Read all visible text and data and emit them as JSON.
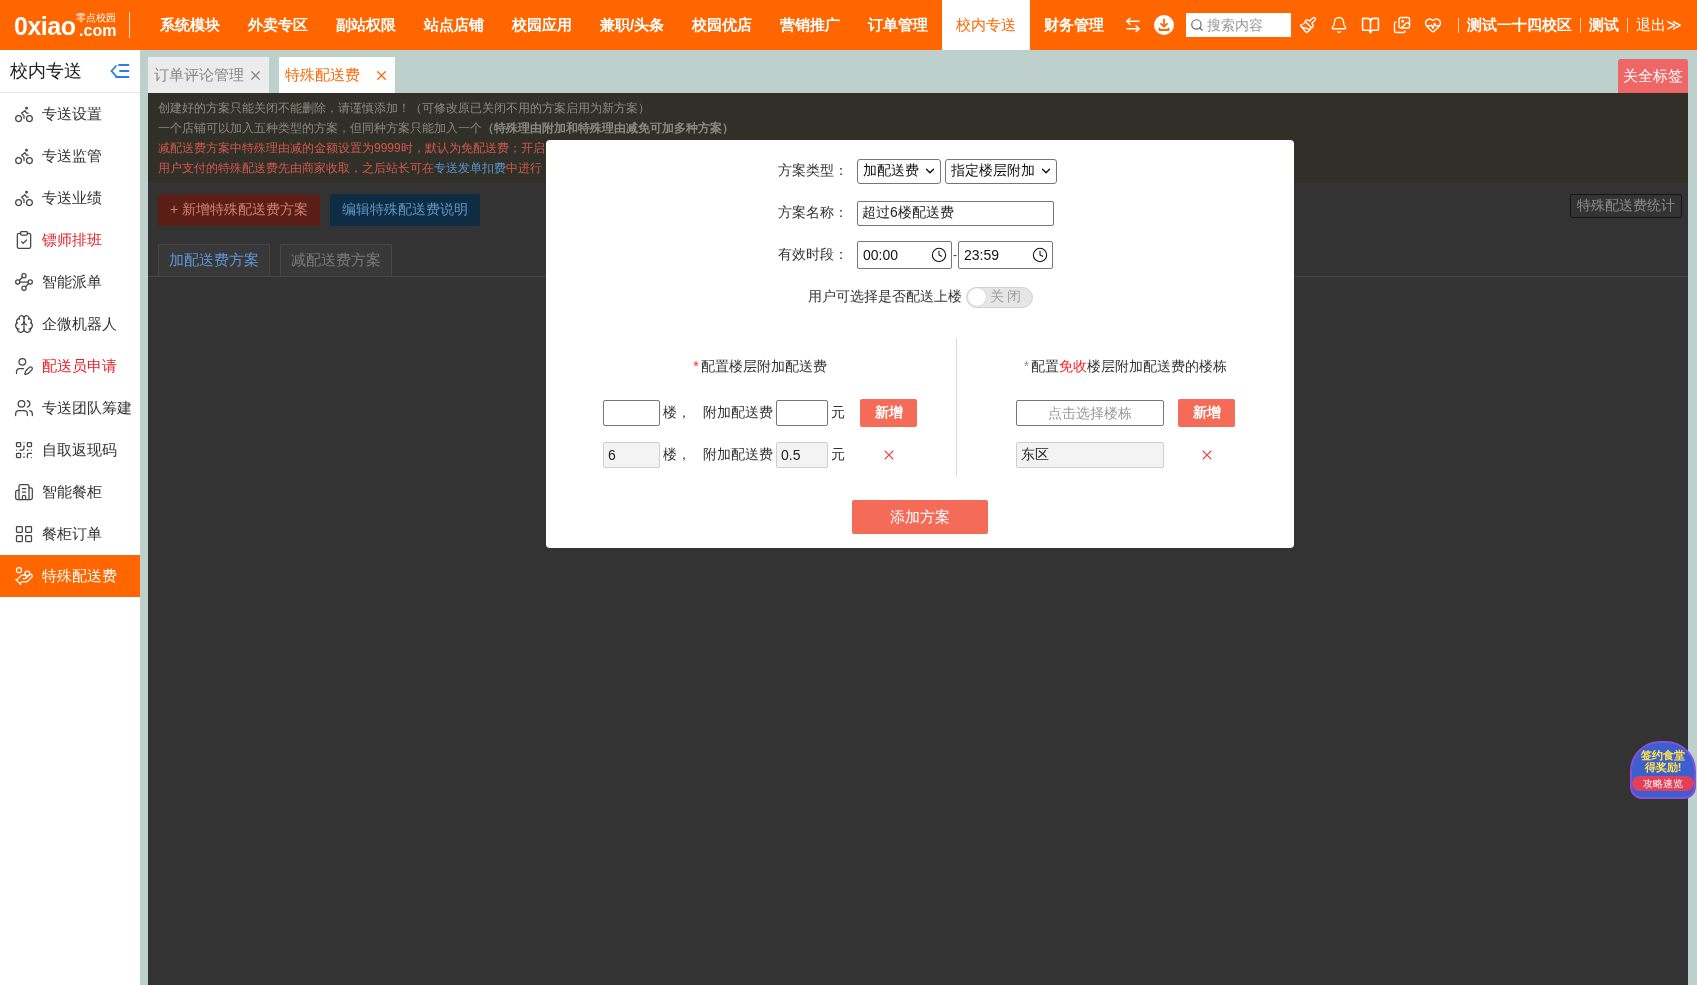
{
  "top_bar": {
    "logo": {
      "wordmark": "0xiao",
      "tagline": "零点校园",
      "domain": ".com"
    },
    "nav": [
      {
        "label": "系统模块",
        "selected": false
      },
      {
        "label": "外卖专区",
        "selected": false
      },
      {
        "label": "副站权限",
        "selected": false
      },
      {
        "label": "站点店铺",
        "selected": false
      },
      {
        "label": "校园应用",
        "selected": false
      },
      {
        "label": "兼职/头条",
        "selected": false
      },
      {
        "label": "校园优店",
        "selected": false
      },
      {
        "label": "营销推广",
        "selected": false
      },
      {
        "label": "订单管理",
        "selected": false
      },
      {
        "label": "校内专送",
        "selected": true
      },
      {
        "label": "财务管理",
        "selected": false
      }
    ],
    "search": {
      "placeholder": "搜索内容"
    },
    "campus": "测试一十四校区",
    "user": "测试",
    "logout": "退出≫"
  },
  "sidebar": {
    "title": "校内专送",
    "items": [
      {
        "label": "专送设置",
        "highlighted": false,
        "selected": false
      },
      {
        "label": "专送监管",
        "highlighted": false,
        "selected": false
      },
      {
        "label": "专送业绩",
        "highlighted": false,
        "selected": false
      },
      {
        "label": "镖师排班",
        "highlighted": true,
        "selected": false
      },
      {
        "label": "智能派单",
        "highlighted": false,
        "selected": false
      },
      {
        "label": "企微机器人",
        "highlighted": false,
        "selected": false
      },
      {
        "label": "配送员申请",
        "highlighted": true,
        "selected": false
      },
      {
        "label": "专送团队筹建",
        "highlighted": false,
        "selected": false
      },
      {
        "label": "自取返现码",
        "highlighted": false,
        "selected": false
      },
      {
        "label": "智能餐柜",
        "highlighted": false,
        "selected": false
      },
      {
        "label": "餐柜订单",
        "highlighted": false,
        "selected": false
      },
      {
        "label": "特殊配送费",
        "highlighted": false,
        "selected": true
      }
    ]
  },
  "tab_bar": {
    "tabs": [
      {
        "label": "订单评论管理",
        "selected": false
      },
      {
        "label": "特殊配送费",
        "selected": true
      }
    ],
    "close_all": "关全标签"
  },
  "page": {
    "notices": [
      {
        "kind": "plain",
        "text": "创建好的方案只能关闭不能删除，请谨慎添加！（可修改原已关闭不用的方案启用为新方案）"
      },
      {
        "kind": "plain",
        "text": "一个店铺可以加入五种类型的方案，但同种方案只能加入一个**（特殊理由附加和特殊理由减免可加多种方案）**"
      },
      {
        "kind": "warning",
        "text": "减配送费方案中特殊理由减的金额设置为9999时，默认为免配送费；开启"
      },
      {
        "kind": "warning",
        "text": "用户支付的特殊配送费先由商家收取，之后站长可在",
        "link": "专送发单扣费",
        "text_after": "中进行"
      }
    ],
    "actions": [
      {
        "kind": "danger",
        "label": "+ 新增特殊配送费方案"
      },
      {
        "kind": "primary",
        "label": "编辑特殊配送费说明"
      }
    ],
    "stats_button": "特殊配送费统计",
    "plan_tabs": [
      {
        "label": "加配送费方案",
        "selected": true
      },
      {
        "label": "减配送费方案",
        "selected": false
      }
    ]
  },
  "dialog": {
    "plan_type": {
      "label": "方案类型：",
      "values": [
        "加配送费",
        "指定楼层附加"
      ]
    },
    "plan_name": {
      "label": "方案名称：",
      "value": "超过6楼配送费"
    },
    "period": {
      "label": "有效时段：",
      "start": "00:00",
      "separator": "-",
      "end": "23:59"
    },
    "deliver_upstairs": {
      "label": "用户可选择是否配送上楼",
      "on": false,
      "state_text": "关 闭"
    },
    "floor_fees": {
      "marker": "*",
      "required": true,
      "title": "配置楼层附加配送费",
      "rows": [
        {
          "kind": "new",
          "disabled": false,
          "floor_unit": "楼，",
          "fee_label": "附加配送费",
          "currency": "元",
          "button": "新增"
        },
        {
          "kind": "saved",
          "disabled": true,
          "floor": "6",
          "floor_unit": "楼，",
          "fee_label": "附加配送费",
          "fee": "0.5",
          "currency": "元"
        }
      ]
    },
    "exempt_buildings": {
      "marker": "*",
      "required": false,
      "title_before": "配置",
      "title_highlight": "免收",
      "title_after": "楼层附加配送费的楼栋",
      "rows": [
        {
          "kind": "new",
          "disabled": false,
          "placeholder": "点击选择楼栋",
          "button": "新增"
        },
        {
          "kind": "saved",
          "disabled": true,
          "building": "东区"
        }
      ]
    },
    "submit": "添加方案"
  },
  "promo_sticker": {
    "line_1": "签约食堂",
    "line_2": "得奖励!",
    "cta": "攻略速览"
  }
}
